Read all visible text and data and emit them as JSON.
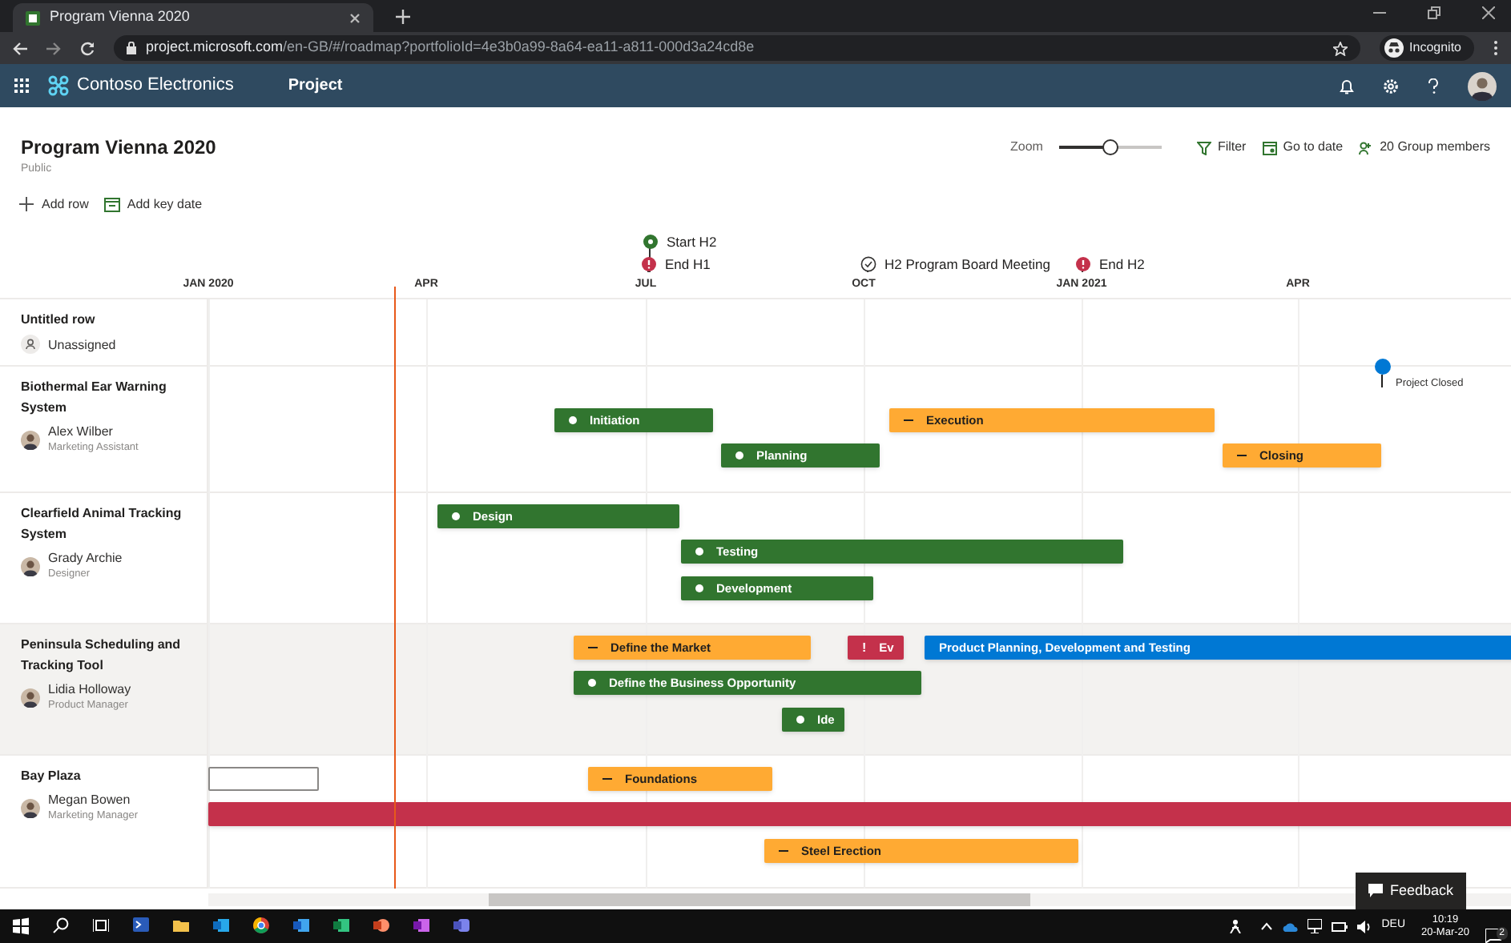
{
  "browser": {
    "tab_title": "Program Vienna 2020",
    "url_host": "project.microsoft.com",
    "url_path": "/en-GB/#/roadmap?portfolioId=4e3b0a99-8a64-ea11-a811-000d3a24cd8e",
    "profile": "Incognito"
  },
  "app_bar": {
    "brand": "Contoso Electronics",
    "app": "Project"
  },
  "page": {
    "title": "Program Vienna 2020",
    "subtitle": "Public"
  },
  "toolbar": {
    "zoom": {
      "label": "Zoom",
      "level": 0.5
    },
    "actions": [
      "Filter",
      "Go to date",
      "20 Group members"
    ],
    "left_actions": [
      "Add row",
      "Add key date"
    ]
  },
  "timeline": {
    "months": [
      "JAN 2020",
      "APR",
      "JUL",
      "OCT",
      "JAN 2021",
      "APR"
    ],
    "key_dates": [
      {
        "label": "Start H2",
        "kind": "start"
      },
      {
        "label": "End H1",
        "kind": "end"
      },
      {
        "label": "H2 Program Board Meeting",
        "kind": "done"
      },
      {
        "label": "End H2",
        "kind": "end"
      }
    ]
  },
  "rows": [
    {
      "name": "Untitled row",
      "owner": "Unassigned",
      "kind": "placeholder",
      "shaded": false,
      "bars": []
    },
    {
      "name": "Biothermal Ear Warning System",
      "owner": "Alex Wilber",
      "role": "Marketing Assistant",
      "kind": "photo",
      "shaded": false,
      "milestone": {
        "label": "Project Closed",
        "color": "#0078d4"
      },
      "bars": [
        {
          "label": "Initiation",
          "kind": "dot",
          "color": "#31752f"
        },
        {
          "label": "Execution",
          "kind": "dash",
          "color": "#ffaa33"
        },
        {
          "label": "Planning",
          "kind": "dot",
          "color": "#31752f"
        },
        {
          "label": "Closing",
          "kind": "dash",
          "color": "#ffaa33"
        }
      ]
    },
    {
      "name": "Clearfield Animal Tracking System",
      "owner": "Grady Archie",
      "role": "Designer",
      "kind": "photo",
      "shaded": false,
      "bars": [
        {
          "label": "Design",
          "kind": "dot",
          "color": "#31752f"
        },
        {
          "label": "Testing",
          "kind": "dot",
          "color": "#31752f"
        },
        {
          "label": "Development",
          "kind": "dot",
          "color": "#31752f"
        }
      ]
    },
    {
      "name": "Peninsula Scheduling and Tracking Tool",
      "owner": "Lidia Holloway",
      "role": "Product Manager",
      "kind": "photo",
      "shaded": true,
      "bars": [
        {
          "label": "Define the Market",
          "kind": "dash",
          "color": "#ffaa33"
        },
        {
          "label": "Ev",
          "kind": "alert",
          "mark": "!",
          "color": "#c4314b"
        },
        {
          "label": "Product Planning, Development and Testing",
          "kind": "plain",
          "color": "#0078d4"
        },
        {
          "label": "Define the Business Opportunity",
          "kind": "dot",
          "color": "#31752f"
        },
        {
          "label": "Ide",
          "kind": "dot",
          "color": "#31752f"
        }
      ]
    },
    {
      "name": "Bay Plaza",
      "owner": "Megan Bowen",
      "role": "Marketing Manager",
      "kind": "photo",
      "shaded": false,
      "bars": [
        {
          "kind": "outline",
          "color": "#ffffff"
        },
        {
          "label": "Foundations",
          "kind": "dash",
          "color": "#ffaa33"
        },
        {
          "kind": "plain",
          "color": "#c4314b"
        },
        {
          "label": "Steel Erection",
          "kind": "dash",
          "color": "#ffaa33"
        }
      ]
    }
  ],
  "feedback": "Feedback",
  "taskbar": {
    "language": "DEU",
    "time": "10:19",
    "date": "20-Mar-20",
    "notifications": "2"
  }
}
